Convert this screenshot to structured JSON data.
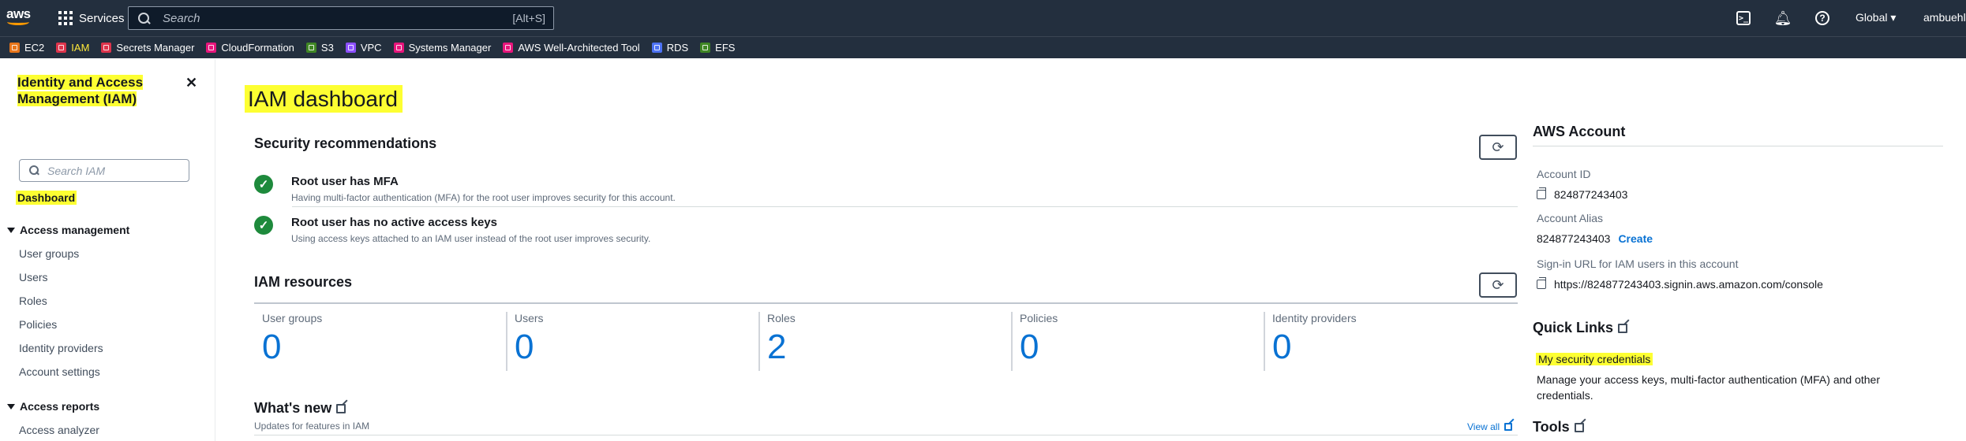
{
  "topnav": {
    "logo_text": "aws",
    "services_label": "Services",
    "search_placeholder": "Search",
    "search_shortcut": "[Alt+S]",
    "cloudshell_glyph": ">_",
    "region_label": "Global ▾",
    "account_label": "ambuehl@"
  },
  "favorites": [
    {
      "label": "EC2",
      "color": "#e8751a"
    },
    {
      "label": "IAM",
      "color": "#dd344c",
      "highlighted": true
    },
    {
      "label": "Secrets Manager",
      "color": "#dd344c"
    },
    {
      "label": "CloudFormation",
      "color": "#e7157b"
    },
    {
      "label": "S3",
      "color": "#3f8624"
    },
    {
      "label": "VPC",
      "color": "#8c4fff"
    },
    {
      "label": "Systems Manager",
      "color": "#e7157b"
    },
    {
      "label": "AWS Well-Architected Tool",
      "color": "#e7157b"
    },
    {
      "label": "RDS",
      "color": "#4d72f3"
    },
    {
      "label": "EFS",
      "color": "#3f8624"
    }
  ],
  "sidebar": {
    "title": "Identity and Access Management (IAM)",
    "close_glyph": "✕",
    "search_placeholder": "Search IAM",
    "dashboard": "Dashboard",
    "access_management": "Access management",
    "am_items": [
      "User groups",
      "Users",
      "Roles",
      "Policies",
      "Identity providers",
      "Account settings"
    ],
    "access_reports": "Access reports",
    "ar_items": [
      "Access analyzer"
    ]
  },
  "main": {
    "title": "IAM dashboard",
    "security_heading": "Security recommendations",
    "recommendations": [
      {
        "title": "Root user has MFA",
        "desc": "Having multi-factor authentication (MFA) for the root user improves security for this account."
      },
      {
        "title": "Root user has no active access keys",
        "desc": "Using access keys attached to an IAM user instead of the root user improves security."
      }
    ],
    "resources_heading": "IAM resources",
    "resources": [
      {
        "label": "User groups",
        "value": "0"
      },
      {
        "label": "Users",
        "value": "0"
      },
      {
        "label": "Roles",
        "value": "2"
      },
      {
        "label": "Policies",
        "value": "0"
      },
      {
        "label": "Identity providers",
        "value": "0"
      }
    ],
    "whats_new": "What's new",
    "whats_new_sub": "Updates for features in IAM",
    "view_all": "View all"
  },
  "account": {
    "heading": "AWS Account",
    "account_id_label": "Account ID",
    "account_id": "824877243403",
    "alias_label": "Account Alias",
    "alias_value": "824877243403",
    "create": "Create",
    "signin_label": "Sign-in URL for IAM users in this account",
    "signin_url": "https://824877243403.signin.aws.amazon.com/console"
  },
  "quick_links": {
    "heading": "Quick Links",
    "link": "My security credentials",
    "desc": "Manage your access keys, multi-factor authentication (MFA) and other credentials."
  },
  "tools": {
    "heading": "Tools"
  },
  "colors": {
    "nav_bg": "#232f3e",
    "highlight": "#fdff32",
    "link": "#0972d3",
    "success": "#1e8a3c"
  }
}
